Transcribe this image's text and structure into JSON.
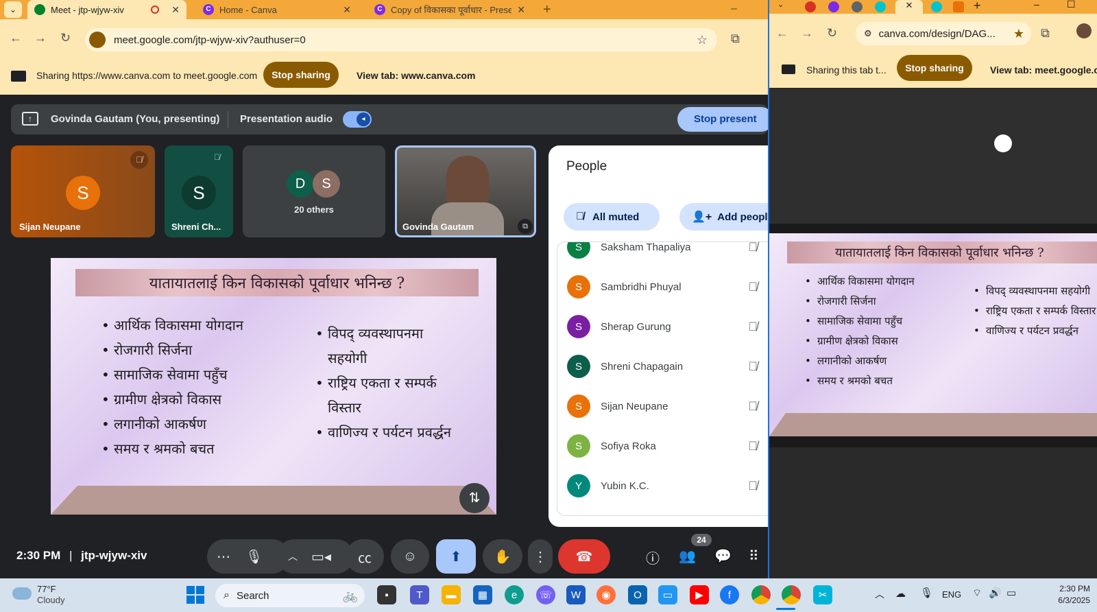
{
  "left_browser": {
    "tabs": [
      {
        "title": "Meet - jtp-wjyw-xiv",
        "active": true
      },
      {
        "title": "Home - Canva",
        "active": false
      },
      {
        "title": "Copy of विकासका पूर्वाधार - Prese",
        "active": false
      }
    ],
    "url": "meet.google.com/jtp-wjyw-xiv?authuser=0",
    "share_text": "Sharing https://www.canva.com to meet.google.com",
    "stop_sharing": "Stop sharing",
    "view_tab": "View tab: www.canva.com"
  },
  "meet": {
    "presenter_text": "Govinda Gautam (You, presenting)",
    "presentation_audio": "Presentation audio",
    "stop_presenting": "Stop present",
    "tiles": [
      {
        "initial": "S",
        "name": "Sijan Neupane",
        "color": "#e8710a"
      },
      {
        "initial": "S",
        "name": "Shreni Ch...",
        "color": "#0d5e4a"
      },
      {
        "initial_a": "D",
        "initial_b": "S",
        "label": "20 others"
      },
      {
        "name": "Govinda Gautam"
      }
    ],
    "slide": {
      "title": "यातायातलाई किन विकासको पूर्वाधार भनिन्छ ?",
      "left_bullets": [
        "आर्थिक विकासमा योगदान",
        "रोजगारी सिर्जना",
        "सामाजिक सेवामा पहुँच",
        "ग्रामीण क्षेत्रको विकास",
        "लगानीको आकर्षण",
        "समय र श्रमको बचत"
      ],
      "right_bullets": [
        "विपद् व्यवस्थापनमा सहयोगी",
        "राष्ट्रिय एकता र सम्पर्क विस्तार",
        "वाणिज्य र पर्यटन प्रवर्द्धन"
      ]
    },
    "people": {
      "title": "People",
      "all_muted": "All muted",
      "add_people": "Add people",
      "list": [
        {
          "initial": "S",
          "name": "Saksham Thapaliya",
          "color": "#0b8043"
        },
        {
          "initial": "S",
          "name": "Sambridhi Phuyal",
          "color": "#e8710a"
        },
        {
          "initial": "S",
          "name": "Sherap Gurung",
          "color": "#7b1fa2"
        },
        {
          "initial": "S",
          "name": "Shreni Chapagain",
          "color": "#0d5e4a"
        },
        {
          "initial": "S",
          "name": "Sijan Neupane",
          "color": "#e8710a"
        },
        {
          "initial": "S",
          "name": "Sofiya Roka",
          "color": "#7cb342"
        },
        {
          "initial": "Y",
          "name": "Yubin K.C.",
          "color": "#00897b"
        }
      ]
    },
    "time": "2:30 PM",
    "meeting_code": "jtp-wjyw-xiv",
    "participants_count": "24"
  },
  "right_browser": {
    "url": "canva.com/design/DAG...",
    "share_text": "Sharing this tab t...",
    "stop_sharing": "Stop sharing",
    "view_tab": "View tab: meet.google.co"
  },
  "taskbar": {
    "temp": "77°F",
    "weather": "Cloudy",
    "search": "Search",
    "lang": "ENG",
    "time": "2:30 PM",
    "date": "6/3/2025"
  }
}
